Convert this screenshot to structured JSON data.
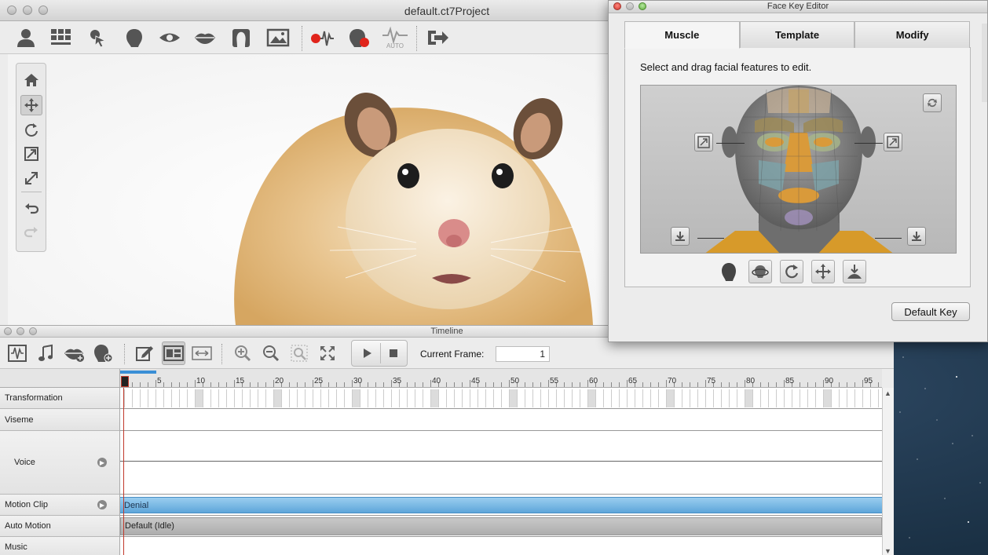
{
  "main_window": {
    "title": "default.ct7Project"
  },
  "toolbar": {
    "icons": [
      "actor-icon",
      "grid-layout-icon",
      "select-pointer-icon",
      "head-icon",
      "eye-icon",
      "lips-icon",
      "face-profile-icon",
      "image-icon",
      "record-voice-icon",
      "record-face-icon",
      "auto-icon",
      "export-icon"
    ],
    "auto_label": "AUTO"
  },
  "timeline": {
    "title": "Timeline",
    "current_frame_label": "Current Frame:",
    "current_frame_value": "1",
    "ruler_ticks": [
      "5",
      "10",
      "15",
      "20",
      "25",
      "30",
      "35",
      "40",
      "45",
      "50",
      "55",
      "60",
      "65",
      "70",
      "75",
      "80",
      "85",
      "90",
      "95"
    ],
    "tracks": [
      {
        "label": "Transformation"
      },
      {
        "label": "Viseme"
      },
      {
        "label": "Voice"
      },
      {
        "label": "Motion Clip"
      },
      {
        "label": "Auto Motion"
      },
      {
        "label": "Music"
      }
    ],
    "motion_clip_name": "Denial",
    "auto_motion_name": "Default (Idle)"
  },
  "face_key_editor": {
    "title": "Face Key Editor",
    "tabs": [
      {
        "label": "Muscle",
        "active": true
      },
      {
        "label": "Template",
        "active": false
      },
      {
        "label": "Modify",
        "active": false
      }
    ],
    "instruction": "Select and drag facial features to edit.",
    "default_key_label": "Default Key"
  },
  "colors": {
    "playhead": "#c0392b",
    "motion_clip": "#74b3e0",
    "auto_motion": "#b5b5b5",
    "record": "#e0241b"
  }
}
